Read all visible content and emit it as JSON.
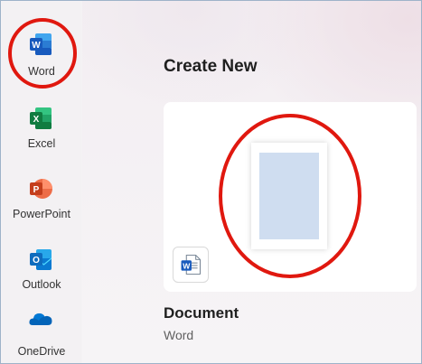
{
  "sidebar": {
    "apps": [
      {
        "name": "word",
        "label": "Word",
        "icon": "word-icon"
      },
      {
        "name": "excel",
        "label": "Excel",
        "icon": "excel-icon"
      },
      {
        "name": "powerpoint",
        "label": "PowerPoint",
        "icon": "powerpoint-icon"
      },
      {
        "name": "outlook",
        "label": "Outlook",
        "icon": "outlook-icon"
      },
      {
        "name": "onedrive",
        "label": "OneDrive",
        "icon": "onedrive-icon"
      }
    ]
  },
  "main": {
    "title": "Create New",
    "templates": [
      {
        "name": "Document",
        "app": "Word",
        "icon": "word-doc-icon"
      }
    ]
  },
  "annotations": {
    "color": "#e0180f",
    "highlighted": [
      "Word",
      "Document"
    ]
  },
  "colors": {
    "word": "#185abd",
    "excel": "#107c41",
    "powerpoint": "#c43e1c",
    "outlook": "#0f6cbd",
    "onedrive": "#0364b8"
  }
}
